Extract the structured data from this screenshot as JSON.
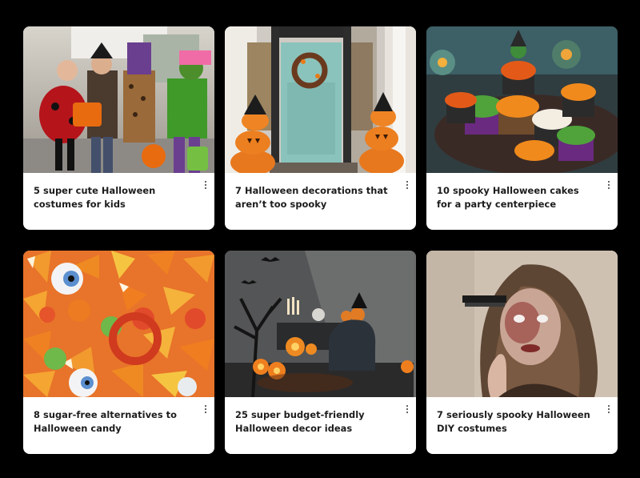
{
  "cards": [
    {
      "title": "5 super cute Halloween costumes for kids",
      "image": "kids-in-halloween-costumes-photo"
    },
    {
      "title": "7 Halloween decorations that aren’t too spooky",
      "image": "porch-with-jack-o-lanterns-photo"
    },
    {
      "title": "10 spooky Halloween cakes for a party centerpiece",
      "image": "halloween-cupcakes-photo"
    },
    {
      "title": "8 sugar-free alternatives to Halloween candy",
      "image": "candy-corn-and-candy-photo"
    },
    {
      "title": "25 super budget-friendly Halloween decor ideas",
      "image": "spooky-living-room-decor-photo"
    },
    {
      "title": "7 seriously spooky Halloween DIY costumes",
      "image": "zombie-makeup-costume-photo"
    }
  ],
  "more_icon": "more-vertical-icon"
}
